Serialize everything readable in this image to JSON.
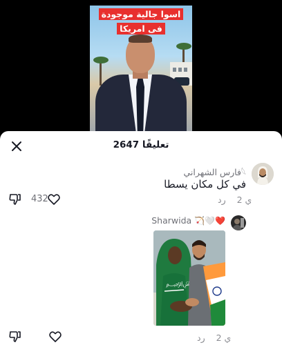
{
  "video": {
    "overlay_title": "اسوا جالية موجودة فى امريكا"
  },
  "comments_panel": {
    "count_label": "2647 تعليقًا",
    "close_icon": "close-icon"
  },
  "comments": [
    {
      "username": "فارس الشهراني",
      "text": "في كل مكان يسطا",
      "time": "2 ي",
      "reply_label": "رد",
      "likes": "432"
    },
    {
      "username": "Sharwida",
      "username_emoji": "🏹🤍❤️",
      "time": "2 ي",
      "reply_label": "رد",
      "likes": ""
    }
  ],
  "colors": {
    "overlay_red": "#e8302e",
    "text_primary": "#161823",
    "text_secondary": "#8a8b91"
  }
}
